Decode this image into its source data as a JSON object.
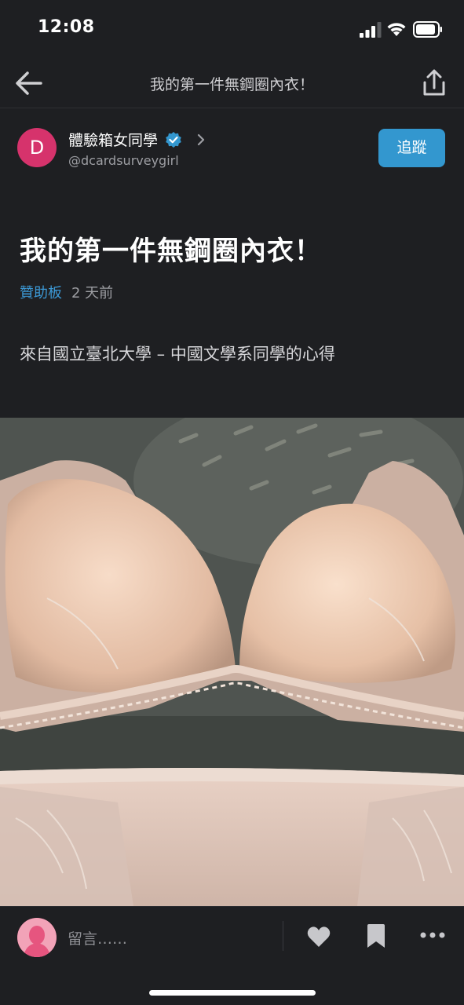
{
  "status_bar": {
    "time": "12:08"
  },
  "nav": {
    "title": "我的第一件無鋼圈內衣！"
  },
  "author": {
    "avatar_letter": "D",
    "name": "體驗箱女同學",
    "handle": "@dcardsurveygirl",
    "follow_label": "追蹤",
    "verified": true
  },
  "post": {
    "title": "我的第一件無鋼圈內衣！",
    "board": "贊助板",
    "time": "2 天前",
    "body": "來自國立臺北大學 – 中國文學系同學的心得"
  },
  "bottom_bar": {
    "comment_placeholder": "留言……"
  },
  "colors": {
    "background": "#1e1f22",
    "accent_blue": "#3397cf",
    "avatar_pink": "#d6336c"
  },
  "icons": [
    "signal-icon",
    "wifi-icon",
    "battery-icon",
    "back-arrow-icon",
    "share-icon",
    "verified-icon",
    "chevron-right-icon",
    "heart-icon",
    "bookmark-icon",
    "more-icon"
  ]
}
